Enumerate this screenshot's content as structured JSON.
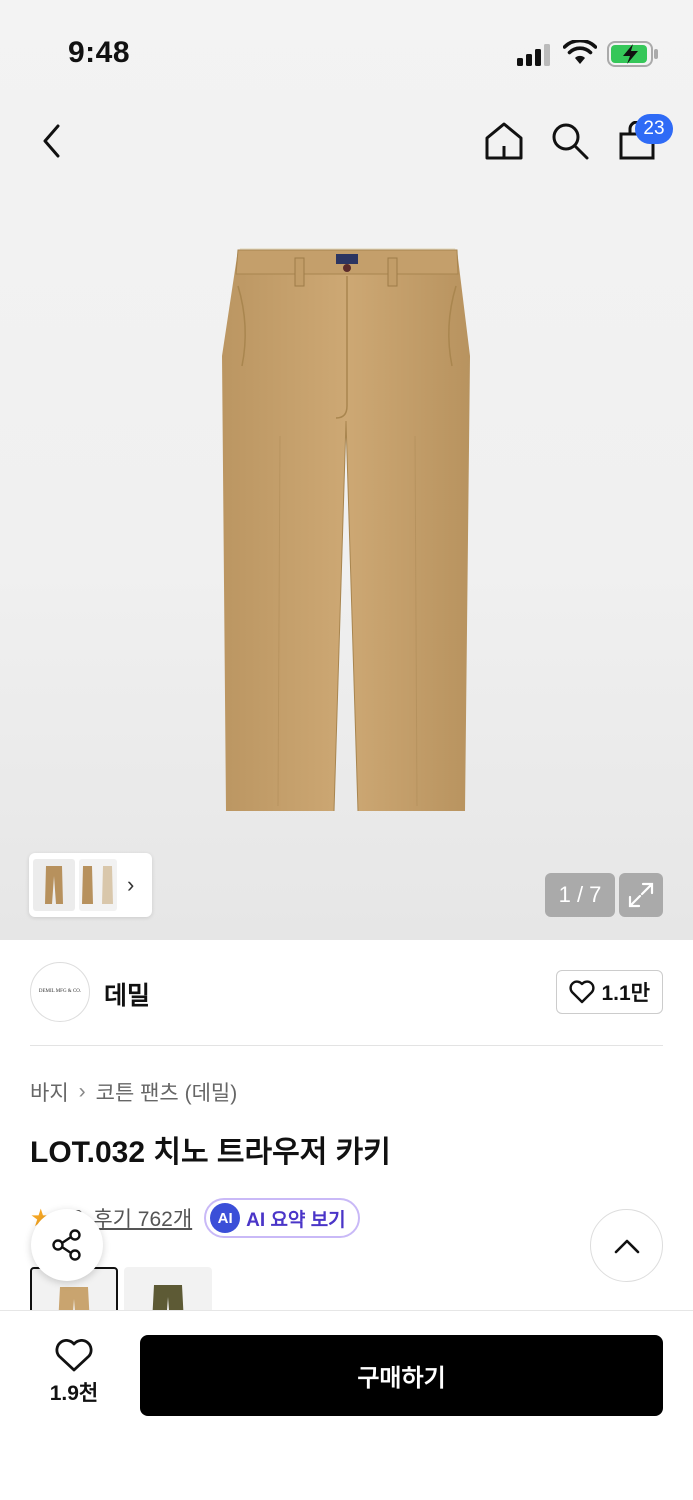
{
  "status_bar": {
    "time": "9:48"
  },
  "header": {
    "cart_count": "23",
    "icons": [
      "chevron-left-icon",
      "home-icon",
      "search-icon",
      "shopping-bag-icon"
    ]
  },
  "gallery": {
    "counter": "1 / 7",
    "current_index": 1,
    "total": 7
  },
  "brand": {
    "name": "데밀",
    "logo_text": "DEMIL MFG & CO.",
    "likes": "1.1만"
  },
  "breadcrumb": {
    "category": "바지",
    "subcategory": "코튼 팬츠 (데밀)"
  },
  "product": {
    "title": "LOT.032 치노 트라우저 카키",
    "rating": "4.9",
    "reviews_label": "후기 762개",
    "ai_badge": "AI",
    "ai_summary_label": "AI 요약 보기"
  },
  "colors": {
    "accent_blue": "#2f6bf6",
    "ai_purple": "#4a35c8",
    "star": "#f5a623",
    "khaki": "#c9a46f",
    "olive": "#5d5a35"
  },
  "bottom_bar": {
    "wish_count": "1.9천",
    "buy_label": "구매하기"
  }
}
